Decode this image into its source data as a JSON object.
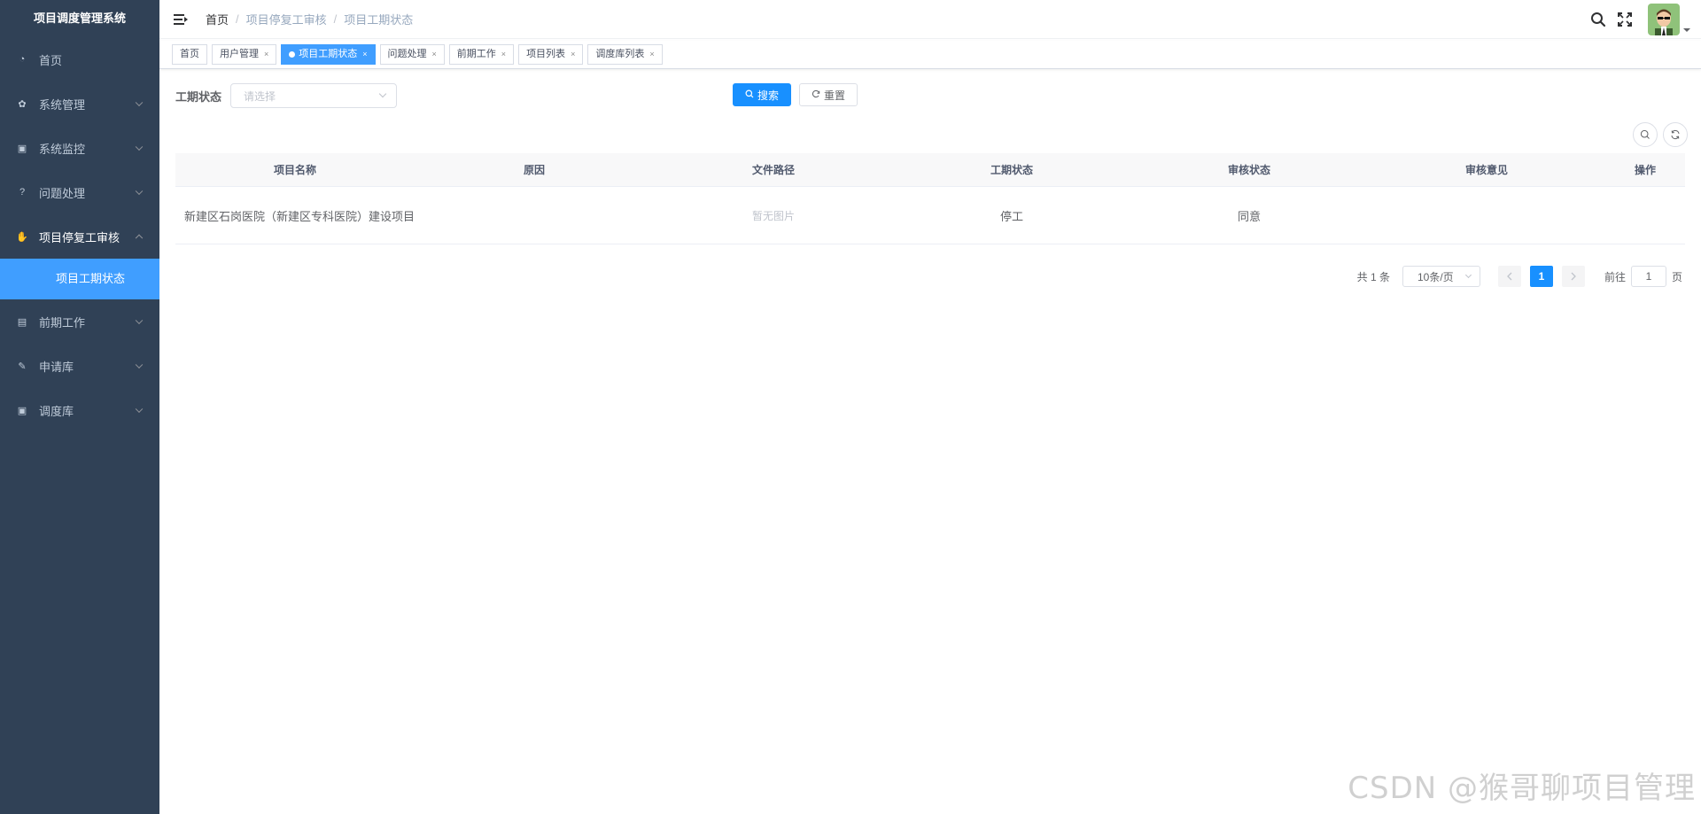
{
  "app": {
    "title": "项目调度管理系统"
  },
  "sidebar": {
    "items": [
      {
        "label": "首页",
        "icon": "dashboard-icon"
      },
      {
        "label": "系统管理",
        "icon": "gear-icon"
      },
      {
        "label": "系统监控",
        "icon": "monitor-icon"
      },
      {
        "label": "问题处理",
        "icon": "question-icon"
      },
      {
        "label": "项目停复工审核",
        "icon": "hand-icon"
      },
      {
        "label": "前期工作",
        "icon": "doc-icon"
      },
      {
        "label": "申请库",
        "icon": "edit-icon"
      },
      {
        "label": "调度库",
        "icon": "monitor-icon"
      }
    ],
    "active_sub": "项目工期状态"
  },
  "navbar": {
    "breadcrumb": [
      "首页",
      "项目停复工审核",
      "项目工期状态"
    ],
    "separator": "/"
  },
  "tags": [
    {
      "label": "首页",
      "closable": false
    },
    {
      "label": "用户管理",
      "closable": true
    },
    {
      "label": "项目工期状态",
      "closable": true,
      "active": true
    },
    {
      "label": "问题处理",
      "closable": true
    },
    {
      "label": "前期工作",
      "closable": true
    },
    {
      "label": "项目列表",
      "closable": true
    },
    {
      "label": "调度库列表",
      "closable": true
    }
  ],
  "tag_close_glyph": "×",
  "search": {
    "label": "工期状态",
    "placeholder": "请选择",
    "search_button": "搜索",
    "reset_button": "重置"
  },
  "table": {
    "headers": [
      "项目名称",
      "原因",
      "文件路径",
      "工期状态",
      "审核状态",
      "审核意见",
      "操作"
    ],
    "rows": [
      {
        "name": "新建区石岗医院（新建区专科医院）建设项目",
        "reason": "",
        "file": "暂无图片",
        "status": "停工",
        "review": "同意",
        "opinion": "",
        "action": ""
      }
    ]
  },
  "pagination": {
    "total": "共 1 条",
    "page_size": "10条/页",
    "current": "1",
    "goto_label": "前往",
    "goto_value": "1",
    "page_unit": "页"
  },
  "watermark": "CSDN @猴哥聊项目管理",
  "colors": {
    "sidebar_bg": "#304156",
    "accent": "#1890ff",
    "active_menu": "#409eff"
  }
}
